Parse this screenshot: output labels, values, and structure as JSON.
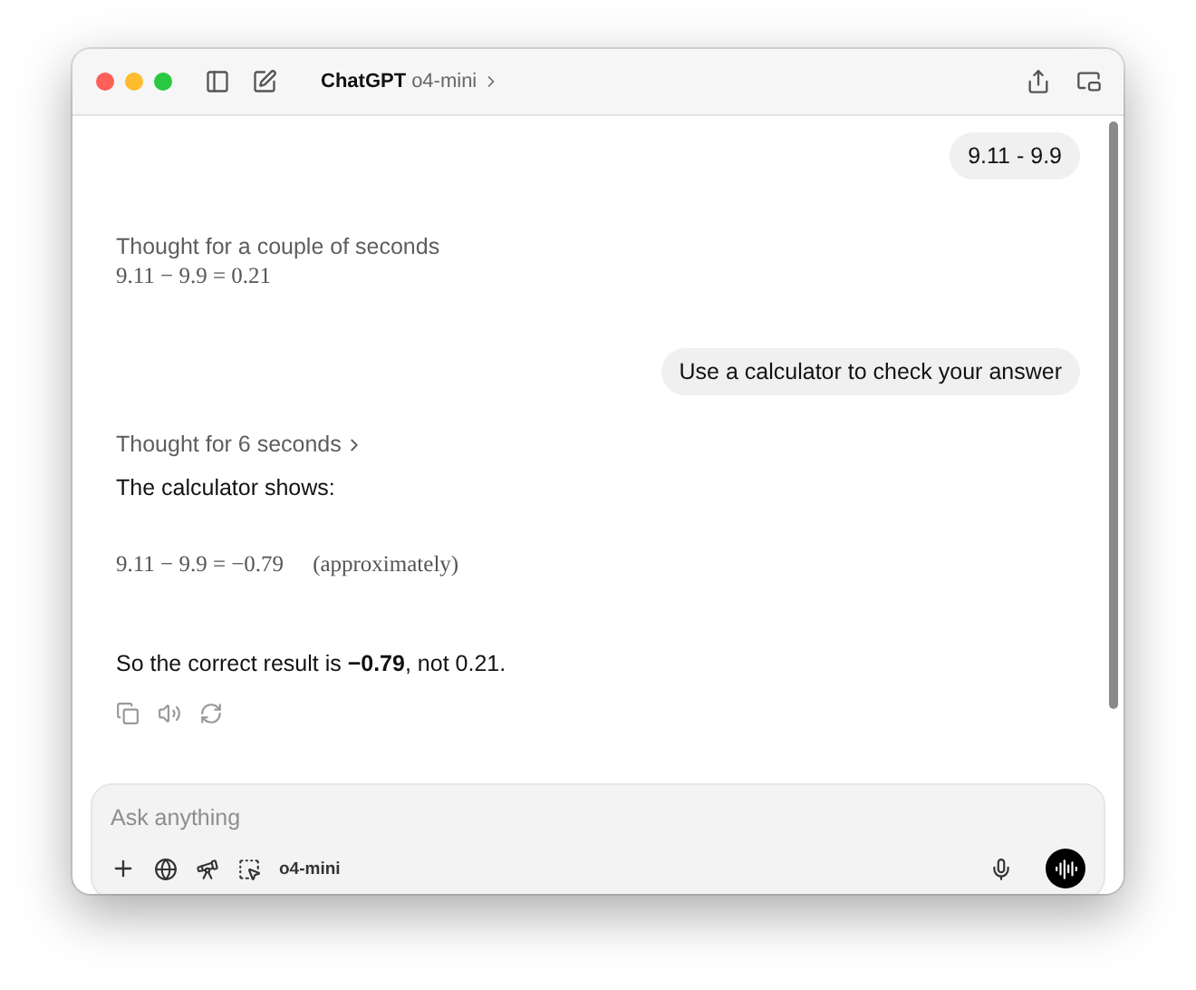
{
  "window": {
    "title": "ChatGPT",
    "model": "o4-mini"
  },
  "messages": [
    {
      "kind": "user",
      "text": "9.11 - 9.9"
    },
    {
      "kind": "assistant",
      "thought": "Thought for a couple of seconds",
      "expandable": false,
      "blocks": [
        {
          "kind": "math",
          "text": "9.11 − 9.9 = 0.21"
        }
      ]
    },
    {
      "kind": "user",
      "text": "Use a calculator to check your answer"
    },
    {
      "kind": "assistant",
      "thought": "Thought for 6 seconds",
      "expandable": true,
      "blocks": [
        {
          "kind": "text",
          "text": "The calculator shows:"
        },
        {
          "kind": "math",
          "text": "9.11 − 9.9 = −0.79",
          "note": "(approximately)"
        },
        {
          "kind": "text",
          "text": "So the correct result is **−0.79**, not 0.21."
        }
      ],
      "actions": true
    }
  ],
  "composer": {
    "placeholder": "Ask anything",
    "model": "o4-mini"
  }
}
